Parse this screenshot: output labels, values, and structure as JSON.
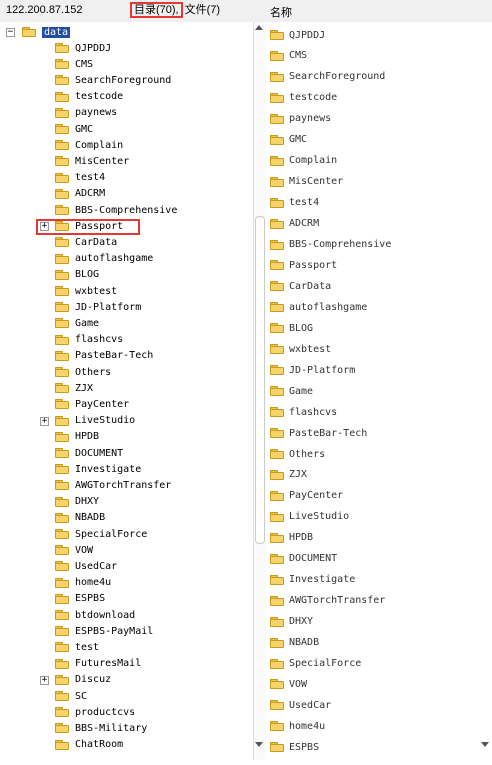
{
  "header": {
    "host": "122.200.87.152",
    "dir_label": "目录(70),",
    "file_label": "文件(7)",
    "column": "名称"
  },
  "tree": {
    "root": "data",
    "items": [
      "QJPDDJ",
      "CMS",
      "SearchForeground",
      "testcode",
      "paynews",
      "GMC",
      "Complain",
      "MisCenter",
      "test4",
      "ADCRM",
      "BBS-Comprehensive",
      "Passport",
      "CarData",
      "autoflashgame",
      "BLOG",
      "wxbtest",
      "JD-Platform",
      "Game",
      "flashcvs",
      "PasteBar-Tech",
      "Others",
      "ZJX",
      "PayCenter",
      "LiveStudio",
      "HPDB",
      "DOCUMENT",
      "Investigate",
      "AWGTorchTransfer",
      "DHXY",
      "NBADB",
      "SpecialForce",
      "VOW",
      "UsedCar",
      "home4u",
      "ESPBS",
      "btdownload",
      "ESPBS-PayMail",
      "test",
      "FuturesMail",
      "Discuz",
      "SC",
      "productcvs",
      "BBS-Military",
      "ChatRoom"
    ],
    "expanders": {
      "Passport": "+",
      "LiveStudio": "+",
      "Discuz": "+"
    },
    "root_expander": "−"
  },
  "list": {
    "items": [
      "QJPDDJ",
      "CMS",
      "SearchForeground",
      "testcode",
      "paynews",
      "GMC",
      "Complain",
      "MisCenter",
      "test4",
      "ADCRM",
      "BBS-Comprehensive",
      "Passport",
      "CarData",
      "autoflashgame",
      "BLOG",
      "wxbtest",
      "JD-Platform",
      "Game",
      "flashcvs",
      "PasteBar-Tech",
      "Others",
      "ZJX",
      "PayCenter",
      "LiveStudio",
      "HPDB",
      "DOCUMENT",
      "Investigate",
      "AWGTorchTransfer",
      "DHXY",
      "NBADB",
      "SpecialForce",
      "VOW",
      "UsedCar",
      "home4u",
      "ESPBS"
    ]
  }
}
